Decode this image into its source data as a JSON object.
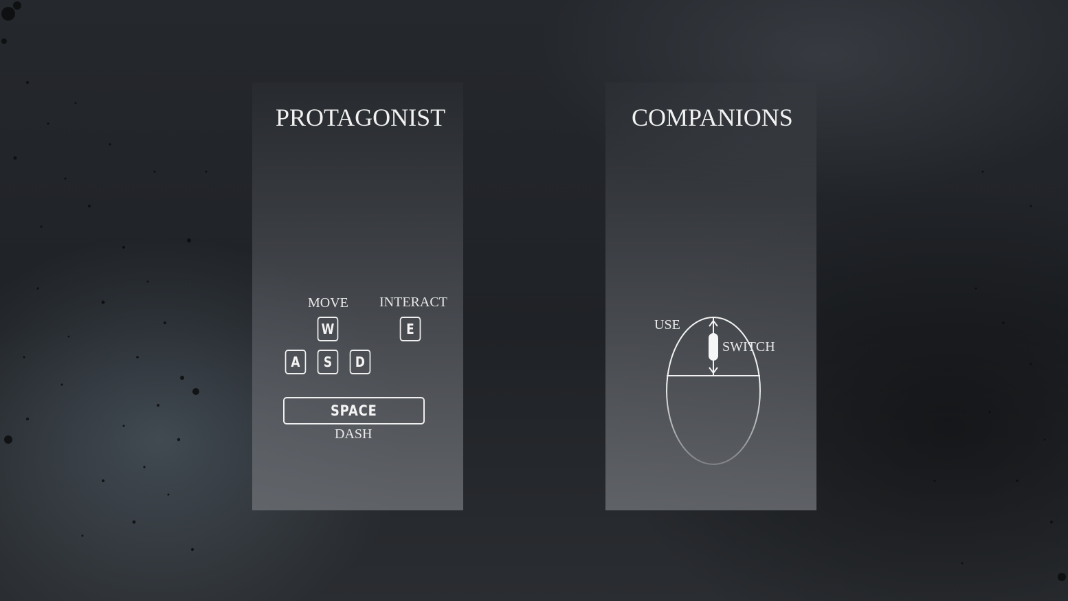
{
  "protagonist": {
    "title": "PROTAGONIST",
    "move_label": "MOVE",
    "interact_label": "INTERACT",
    "dash_label": "DASH",
    "keys": {
      "w": "W",
      "a": "A",
      "s": "S",
      "d": "D",
      "e": "E",
      "space": "SPACE"
    }
  },
  "companions": {
    "title": "COMPANIONS",
    "use_label": "USE",
    "switch_label": "SWITCH",
    "mouse_icon": "mouse-icon"
  },
  "colors": {
    "text": "#f2f2f2",
    "panel": "#5f6268",
    "background": "#1f2226"
  }
}
